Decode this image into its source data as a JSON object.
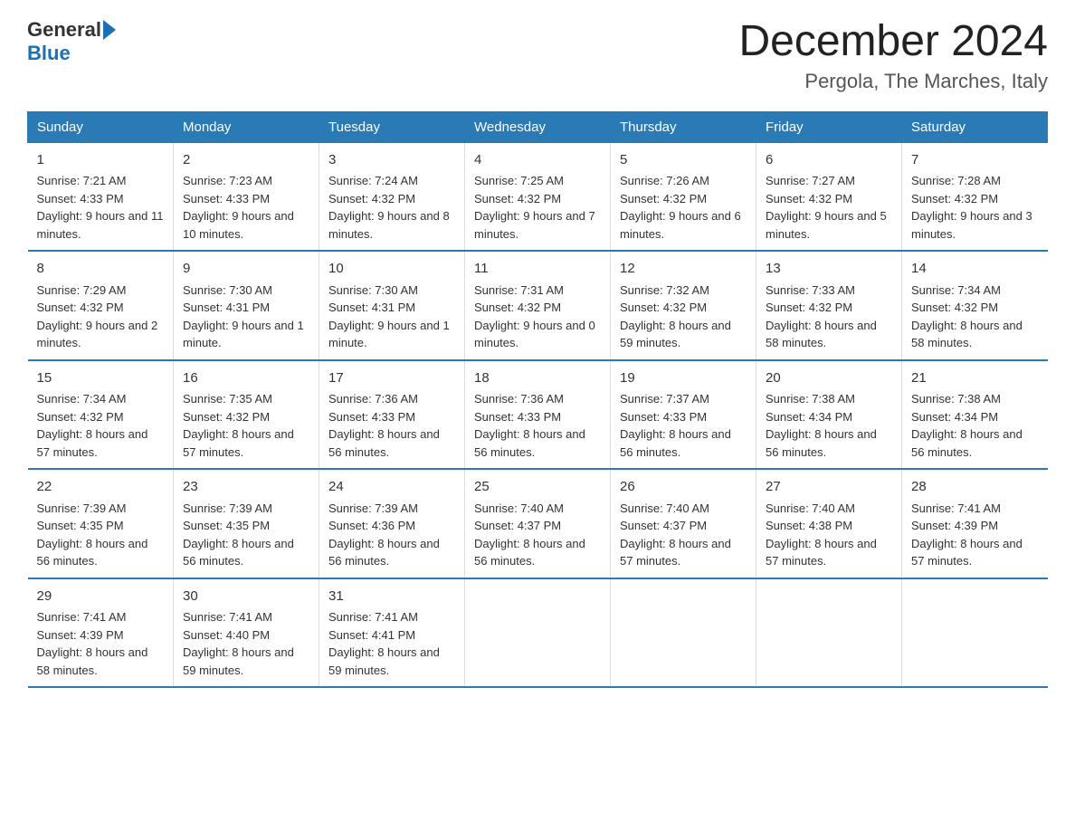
{
  "logo": {
    "general": "General",
    "blue": "Blue"
  },
  "title": "December 2024",
  "subtitle": "Pergola, The Marches, Italy",
  "days_of_week": [
    "Sunday",
    "Monday",
    "Tuesday",
    "Wednesday",
    "Thursday",
    "Friday",
    "Saturday"
  ],
  "weeks": [
    [
      {
        "day": "1",
        "sunrise": "7:21 AM",
        "sunset": "4:33 PM",
        "daylight": "9 hours and 11 minutes."
      },
      {
        "day": "2",
        "sunrise": "7:23 AM",
        "sunset": "4:33 PM",
        "daylight": "9 hours and 10 minutes."
      },
      {
        "day": "3",
        "sunrise": "7:24 AM",
        "sunset": "4:32 PM",
        "daylight": "9 hours and 8 minutes."
      },
      {
        "day": "4",
        "sunrise": "7:25 AM",
        "sunset": "4:32 PM",
        "daylight": "9 hours and 7 minutes."
      },
      {
        "day": "5",
        "sunrise": "7:26 AM",
        "sunset": "4:32 PM",
        "daylight": "9 hours and 6 minutes."
      },
      {
        "day": "6",
        "sunrise": "7:27 AM",
        "sunset": "4:32 PM",
        "daylight": "9 hours and 5 minutes."
      },
      {
        "day": "7",
        "sunrise": "7:28 AM",
        "sunset": "4:32 PM",
        "daylight": "9 hours and 3 minutes."
      }
    ],
    [
      {
        "day": "8",
        "sunrise": "7:29 AM",
        "sunset": "4:32 PM",
        "daylight": "9 hours and 2 minutes."
      },
      {
        "day": "9",
        "sunrise": "7:30 AM",
        "sunset": "4:31 PM",
        "daylight": "9 hours and 1 minute."
      },
      {
        "day": "10",
        "sunrise": "7:30 AM",
        "sunset": "4:31 PM",
        "daylight": "9 hours and 1 minute."
      },
      {
        "day": "11",
        "sunrise": "7:31 AM",
        "sunset": "4:32 PM",
        "daylight": "9 hours and 0 minutes."
      },
      {
        "day": "12",
        "sunrise": "7:32 AM",
        "sunset": "4:32 PM",
        "daylight": "8 hours and 59 minutes."
      },
      {
        "day": "13",
        "sunrise": "7:33 AM",
        "sunset": "4:32 PM",
        "daylight": "8 hours and 58 minutes."
      },
      {
        "day": "14",
        "sunrise": "7:34 AM",
        "sunset": "4:32 PM",
        "daylight": "8 hours and 58 minutes."
      }
    ],
    [
      {
        "day": "15",
        "sunrise": "7:34 AM",
        "sunset": "4:32 PM",
        "daylight": "8 hours and 57 minutes."
      },
      {
        "day": "16",
        "sunrise": "7:35 AM",
        "sunset": "4:32 PM",
        "daylight": "8 hours and 57 minutes."
      },
      {
        "day": "17",
        "sunrise": "7:36 AM",
        "sunset": "4:33 PM",
        "daylight": "8 hours and 56 minutes."
      },
      {
        "day": "18",
        "sunrise": "7:36 AM",
        "sunset": "4:33 PM",
        "daylight": "8 hours and 56 minutes."
      },
      {
        "day": "19",
        "sunrise": "7:37 AM",
        "sunset": "4:33 PM",
        "daylight": "8 hours and 56 minutes."
      },
      {
        "day": "20",
        "sunrise": "7:38 AM",
        "sunset": "4:34 PM",
        "daylight": "8 hours and 56 minutes."
      },
      {
        "day": "21",
        "sunrise": "7:38 AM",
        "sunset": "4:34 PM",
        "daylight": "8 hours and 56 minutes."
      }
    ],
    [
      {
        "day": "22",
        "sunrise": "7:39 AM",
        "sunset": "4:35 PM",
        "daylight": "8 hours and 56 minutes."
      },
      {
        "day": "23",
        "sunrise": "7:39 AM",
        "sunset": "4:35 PM",
        "daylight": "8 hours and 56 minutes."
      },
      {
        "day": "24",
        "sunrise": "7:39 AM",
        "sunset": "4:36 PM",
        "daylight": "8 hours and 56 minutes."
      },
      {
        "day": "25",
        "sunrise": "7:40 AM",
        "sunset": "4:37 PM",
        "daylight": "8 hours and 56 minutes."
      },
      {
        "day": "26",
        "sunrise": "7:40 AM",
        "sunset": "4:37 PM",
        "daylight": "8 hours and 57 minutes."
      },
      {
        "day": "27",
        "sunrise": "7:40 AM",
        "sunset": "4:38 PM",
        "daylight": "8 hours and 57 minutes."
      },
      {
        "day": "28",
        "sunrise": "7:41 AM",
        "sunset": "4:39 PM",
        "daylight": "8 hours and 57 minutes."
      }
    ],
    [
      {
        "day": "29",
        "sunrise": "7:41 AM",
        "sunset": "4:39 PM",
        "daylight": "8 hours and 58 minutes."
      },
      {
        "day": "30",
        "sunrise": "7:41 AM",
        "sunset": "4:40 PM",
        "daylight": "8 hours and 59 minutes."
      },
      {
        "day": "31",
        "sunrise": "7:41 AM",
        "sunset": "4:41 PM",
        "daylight": "8 hours and 59 minutes."
      },
      null,
      null,
      null,
      null
    ]
  ]
}
